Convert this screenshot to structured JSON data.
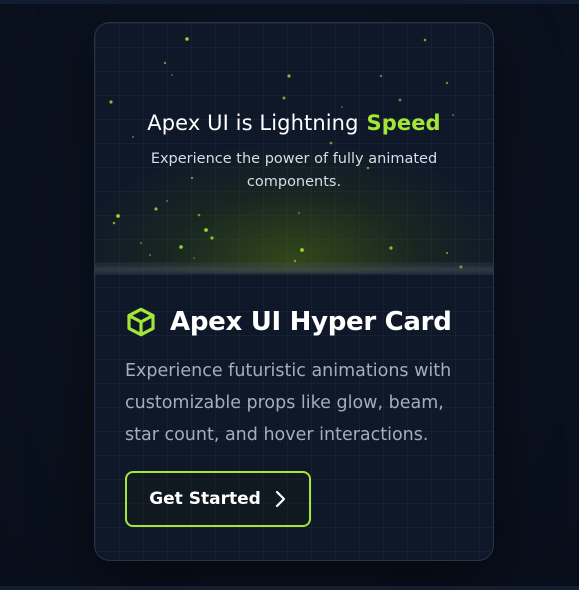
{
  "hero": {
    "title_main": "Apex UI is Lightning",
    "title_accent": "Speed",
    "subtitle": "Experience the power of fully animated components."
  },
  "card": {
    "heading": "Apex UI Hyper Card",
    "heading_icon": "cube-icon",
    "description": "Experience futuristic animations with customizable props like glow, beam, star count, and hover interactions.",
    "cta_label": "Get Started",
    "cta_icon": "chevron-right-icon"
  },
  "colors": {
    "accent": "#a3e635",
    "card_bg": "#0f1829",
    "page_bg": "#0b1220",
    "text_primary": "#ffffff",
    "text_muted": "#a4adbb"
  }
}
